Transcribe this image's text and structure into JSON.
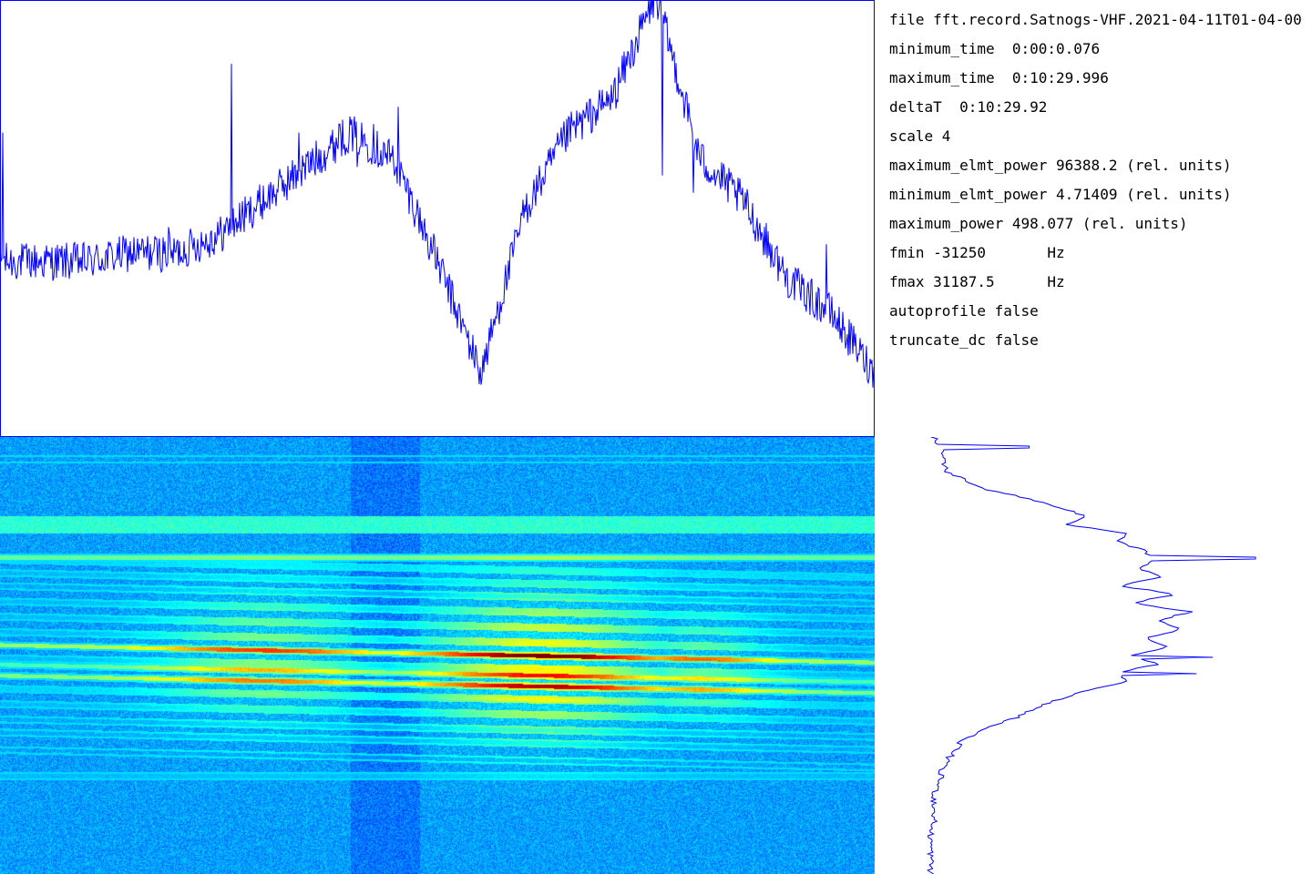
{
  "info": {
    "file": "file fft.record.Satnogs-VHF.2021-04-11T01-04-00",
    "minimum_time": "minimum_time  0:00:0.076",
    "maximum_time": "maximum_time  0:10:29.996",
    "deltaT": "deltaT  0:10:29.92",
    "scale": "scale 4",
    "maximum_elmt_power": "maximum_elmt_power 96388.2 (rel. units)",
    "minimum_elmt_power": "minimum_elmt_power 4.71409 (rel. units)",
    "maximum_power": "maximum_power 498.077 (rel. units)",
    "fmin": "fmin -31250       Hz",
    "fmax": "fmax 31187.5      Hz",
    "autoprofile": "autoprofile false",
    "truncate_dc": "truncate_dc false"
  },
  "colors": {
    "profile_line": "#0000ff",
    "panel_border": "#0000ff",
    "spectrogram_background": "#1e9be6",
    "spectrogram_signal": "#f0e600"
  },
  "chart_data": [
    {
      "type": "line",
      "name": "time-profile",
      "title": "",
      "xlabel": "",
      "ylabel": "",
      "x": [
        0,
        5,
        10,
        15,
        20,
        25,
        30,
        35,
        40,
        45,
        50,
        55,
        60,
        65,
        70,
        75,
        80,
        85,
        90,
        95,
        100
      ],
      "y": [
        70,
        70,
        70,
        71,
        71,
        73,
        77,
        81,
        85,
        82,
        70,
        57,
        76,
        85,
        89,
        101,
        82,
        77,
        68,
        64,
        57
      ],
      "spikes_x": [
        0.3,
        19.3,
        26.5,
        34.2,
        38.8,
        39.9,
        40.8,
        42.7,
        45.5,
        75.7,
        79.3,
        94.5
      ],
      "spikes_y": [
        85,
        74,
        93,
        85,
        86,
        84,
        81,
        86,
        88,
        80,
        78,
        72
      ],
      "ylim": [
        50,
        100
      ],
      "xlim": [
        0,
        100
      ]
    },
    {
      "type": "line",
      "name": "frequency-profile",
      "title": "",
      "xlabel": "",
      "ylabel": "",
      "x": [
        0,
        2,
        4,
        6,
        8,
        10,
        12,
        14,
        16,
        18,
        20,
        22,
        24,
        26,
        28,
        30,
        32,
        34,
        36,
        38,
        40,
        42,
        44,
        46,
        48,
        50,
        52,
        54,
        56,
        58,
        60,
        62,
        64,
        66,
        68,
        70,
        72,
        74,
        76,
        78,
        80,
        82,
        84,
        86,
        88,
        90,
        92,
        94,
        96,
        98,
        100
      ],
      "y": [
        2,
        4,
        5,
        5,
        6,
        12,
        18,
        30,
        40,
        48,
        42,
        60,
        58,
        66,
        70,
        64,
        72,
        58,
        76,
        62,
        80,
        70,
        78,
        66,
        74,
        62,
        70,
        58,
        62,
        48,
        40,
        33,
        28,
        20,
        14,
        10,
        8,
        6,
        4,
        4,
        3,
        2,
        2,
        2,
        2,
        1,
        1,
        1,
        1,
        1,
        1
      ],
      "spikes_x": [
        2.3,
        27.7,
        50.4,
        54.2
      ],
      "spikes_y": [
        31,
        100,
        87,
        82
      ],
      "xlim": [
        0,
        100
      ],
      "ylim": [
        0,
        100
      ]
    },
    {
      "type": "heatmap",
      "name": "spectrogram",
      "title": "",
      "xlabel": "",
      "ylabel": "",
      "xlim": [
        0,
        100
      ],
      "ylim": [
        0,
        100
      ],
      "carrier_rows": [
        {
          "y": 5,
          "level": 0.35
        },
        {
          "y": 20,
          "level": 0.5
        },
        {
          "y": 27.5,
          "level": 0.85
        },
        {
          "y": 30.5,
          "level": 0.6
        },
        {
          "y": 33.5,
          "level": 0.55
        },
        {
          "y": 36.5,
          "level": 0.5
        },
        {
          "y": 40,
          "level": 0.55
        },
        {
          "y": 43.5,
          "level": 0.55
        },
        {
          "y": 47,
          "level": 0.55
        },
        {
          "y": 50,
          "level": 0.95
        },
        {
          "y": 53,
          "level": 0.55
        },
        {
          "y": 54.5,
          "level": 0.8
        },
        {
          "y": 57,
          "level": 0.9
        },
        {
          "y": 60,
          "level": 0.6
        },
        {
          "y": 63.5,
          "level": 0.55
        },
        {
          "y": 67,
          "level": 0.5
        },
        {
          "y": 70,
          "level": 0.5
        },
        {
          "y": 74,
          "level": 0.45
        },
        {
          "y": 77.5,
          "level": 0.55
        }
      ],
      "hot_region": {
        "x_center": 62,
        "y_center": 52,
        "x_spread": 13,
        "y_spread": 18
      }
    }
  ]
}
